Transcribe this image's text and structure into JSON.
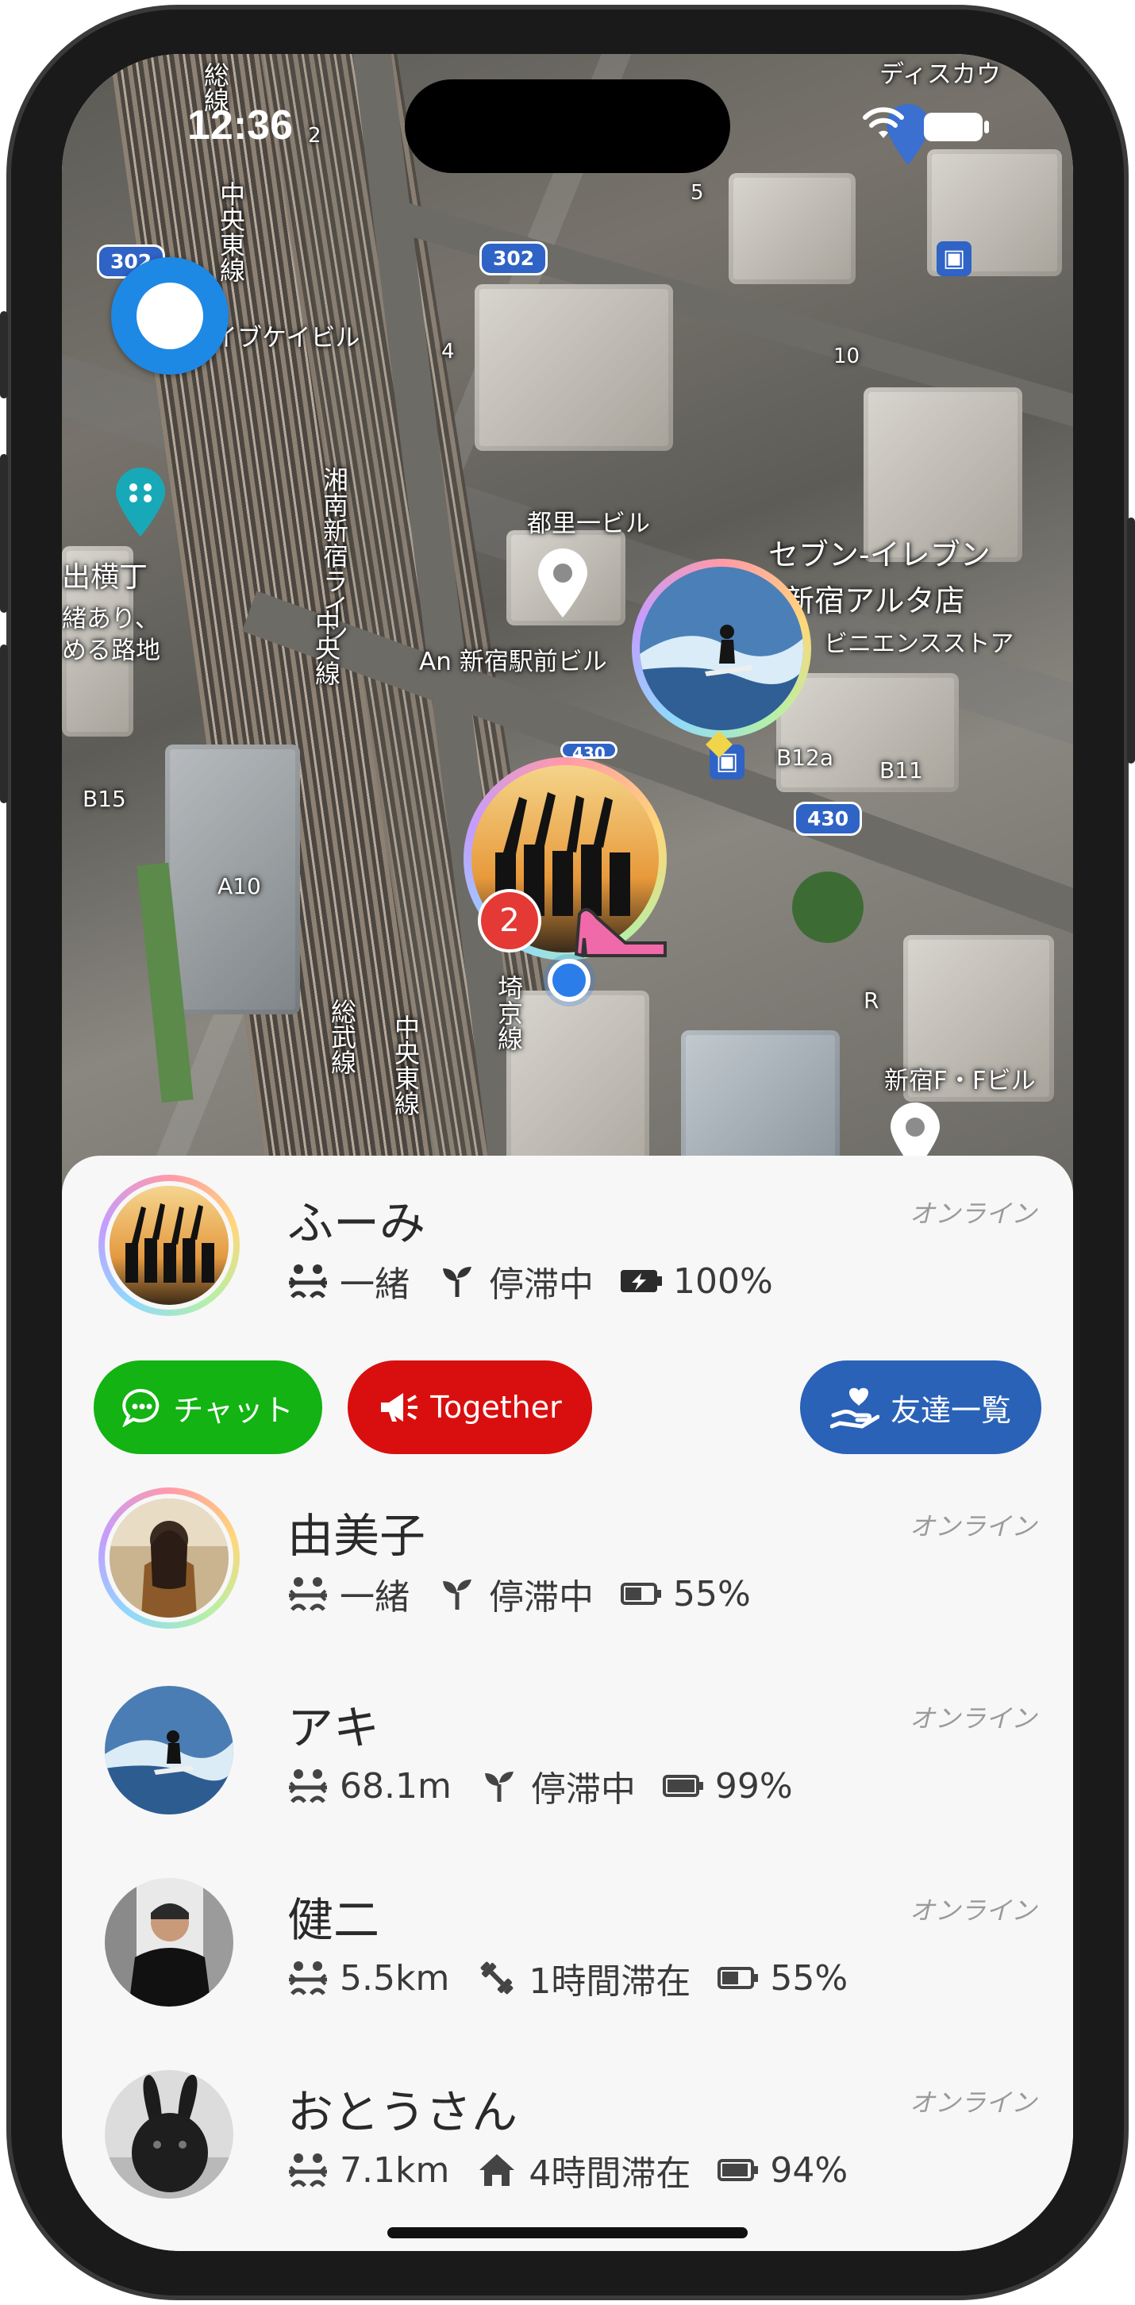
{
  "status_bar": {
    "time": "12:36"
  },
  "map": {
    "labels": [
      "セブン-イレブン",
      "新宿アルタ店",
      "ビニエンスストア",
      "都里一ビル",
      "An 新宿駅前ビル",
      "新宿F・Fビル",
      "イブケイビル",
      "出横丁",
      "緒あり、",
      "める路地",
      "ディスカウ"
    ],
    "vertical_labels": [
      "湘南新宿ライン",
      "中央線",
      "中央東線",
      "総武線",
      "中央東線",
      "埼京線",
      "総線"
    ],
    "shields": [
      "302",
      "302",
      "430",
      "430"
    ],
    "small_labels": [
      "B12a",
      "B11",
      "B15",
      "A10",
      "R",
      "10",
      "4",
      "5",
      "2"
    ],
    "cluster_badge": "2"
  },
  "friends": [
    {
      "name": "ふーみ",
      "status": "オンライン",
      "distance": "一緒",
      "state": "停滞中",
      "battery": "100%",
      "battery_charging": true,
      "ring": true
    },
    {
      "name": "由美子",
      "status": "オンライン",
      "distance": "一緒",
      "state": "停滞中",
      "battery": "55%",
      "ring": true
    },
    {
      "name": "アキ",
      "status": "オンライン",
      "distance": "68.1m",
      "state": "停滞中",
      "battery": "99%",
      "ring": false
    },
    {
      "name": "健二",
      "status": "オンライン",
      "distance": "5.5km",
      "state": "1時間滞在",
      "battery": "55%",
      "ring": false
    },
    {
      "name": "おとうさん",
      "status": "オンライン",
      "distance": "7.1km",
      "state": "4時間滞在",
      "battery": "94%",
      "ring": false
    }
  ],
  "actions": {
    "chat_label": "チャット",
    "together_label": "Together",
    "friends_list_label": "友達一覧"
  },
  "colors": {
    "chat": "#12b312",
    "together": "#d90f0f",
    "friends_list": "#2a62b8",
    "location": "#1e88e5"
  }
}
